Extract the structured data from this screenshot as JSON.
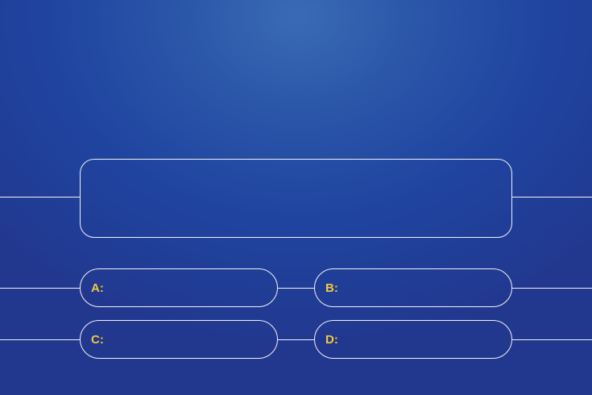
{
  "question": {
    "text": ""
  },
  "answers": [
    {
      "label": "A:",
      "text": ""
    },
    {
      "label": "B:",
      "text": ""
    },
    {
      "label": "C:",
      "text": ""
    },
    {
      "label": "D:",
      "text": ""
    }
  ],
  "colors": {
    "background": "#2a55a8",
    "outline": "#f2f2f2",
    "answer_label": "#f0c93c"
  }
}
